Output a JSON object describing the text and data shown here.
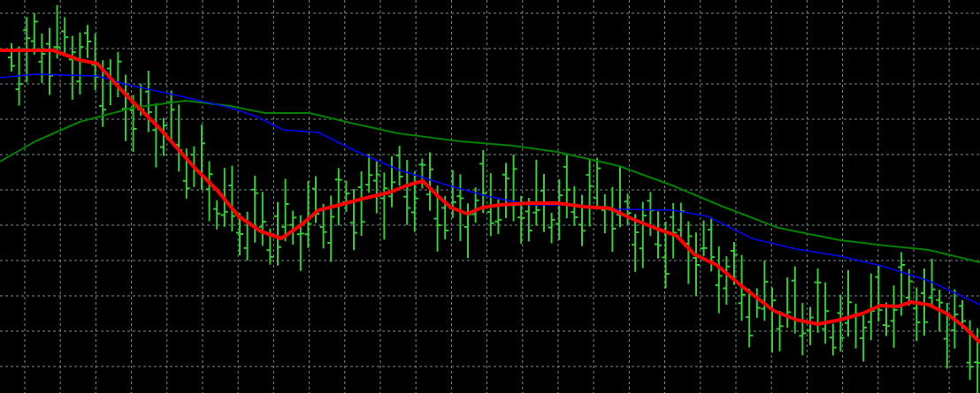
{
  "chart": {
    "lines": [
      {
        "color": "#008000"
      },
      {
        "color": "#0000ff"
      },
      {
        "color": "#ff0000"
      }
    ]
  }
}
